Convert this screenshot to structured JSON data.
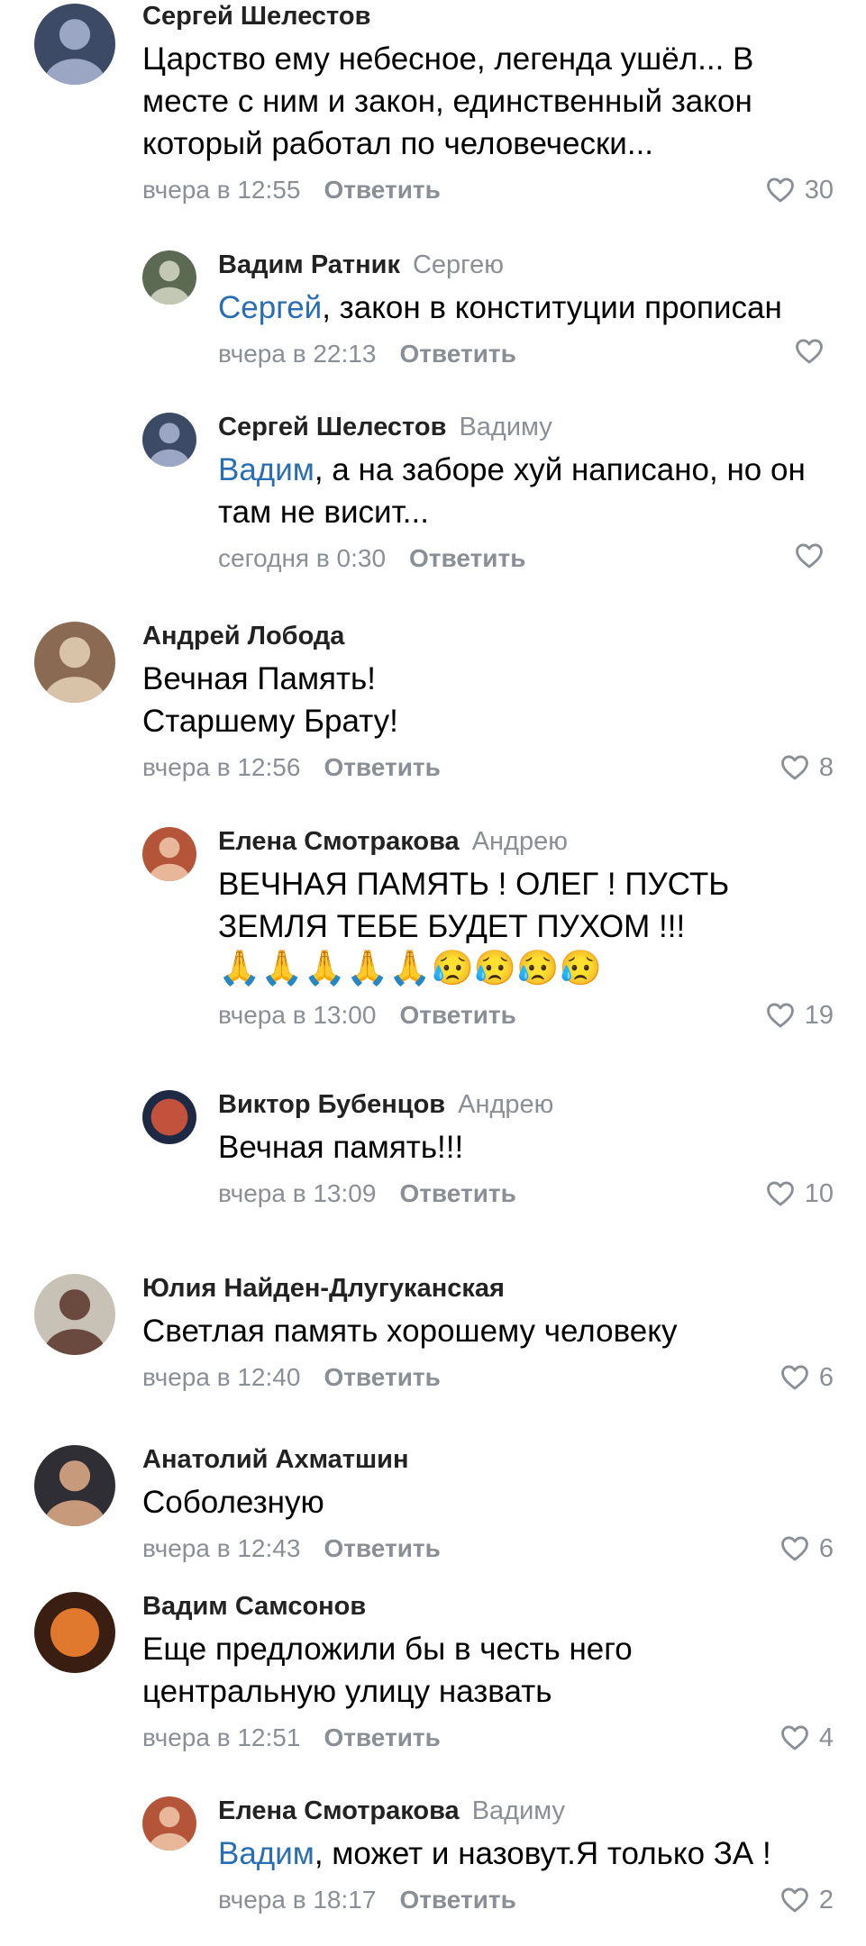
{
  "reply_label": "Ответить",
  "comments": [
    {
      "id": "c1",
      "level": 0,
      "author": "Сергей Шелестов",
      "text": "Царство ему небесное, легенда ушёл... В месте с ним и закон, единственный закон который работал по человечески...",
      "time": "вчера в 12:55",
      "likes": "30",
      "avatar": {
        "bg": "#3c4a66",
        "fg": "#9aa6c4"
      }
    },
    {
      "id": "c2",
      "level": 1,
      "author": "Вадим Ратник",
      "addressee": "Сергею",
      "mention": "Сергей",
      "text": ", закон в конституции прописан",
      "time": "вчера в 22:13",
      "likes": "",
      "avatar": {
        "bg": "#5c6a54",
        "fg": "#c2c8b3"
      }
    },
    {
      "id": "c3",
      "level": 1,
      "author": "Сергей Шелестов",
      "addressee": "Вадиму",
      "mention": "Вадим",
      "text": ", а на заборе хуй написано, но он там не висит...",
      "time": "сегодня в 0:30",
      "likes": "",
      "avatar": {
        "bg": "#3c4a66",
        "fg": "#9aa6c4"
      }
    },
    {
      "id": "c4",
      "level": 0,
      "author": "Андрей Лобода",
      "lines": [
        "Вечная Память!",
        "Старшему Брату!"
      ],
      "time": "вчера в 12:56",
      "likes": "8",
      "avatar": {
        "bg": "#8a6a52",
        "fg": "#d8c2a8"
      }
    },
    {
      "id": "c5",
      "level": 1,
      "author": "Елена Смотракова",
      "addressee": "Андрею",
      "text": "ВЕЧНАЯ ПАМЯТЬ !  ОЛЕГ ! ПУСТЬ ЗЕМЛЯ ТЕБЕ БУДЕТ ПУХОМ !!!",
      "emoji_text": "🙏🙏🙏🙏🙏😥😥😥😥",
      "time": "вчера в 13:00",
      "likes": "19",
      "avatar": {
        "bg": "#b4553a",
        "fg": "#e8b79a"
      }
    },
    {
      "id": "c6",
      "level": 1,
      "author": "Виктор Бубенцов",
      "addressee": "Андрею",
      "text": "Вечная память!!!",
      "time": "вчера в 13:09",
      "likes": "10",
      "avatar": {
        "bg": "#1e2a44",
        "fg": "#c2523c"
      }
    },
    {
      "id": "c7",
      "level": 0,
      "author": "Юлия Найден-Длугуканская",
      "text": "Светлая память хорошему человеку",
      "time": "вчера в 12:40",
      "likes": "6",
      "avatar": {
        "bg": "#c8c2b6",
        "fg": "#6a4a3e"
      }
    },
    {
      "id": "c8",
      "level": 0,
      "author": "Анатолий Ахматшин",
      "text": "Соболезную",
      "time": "вчера в 12:43",
      "likes": "6",
      "avatar": {
        "bg": "#2e2e34",
        "fg": "#c89a7c"
      }
    },
    {
      "id": "c9",
      "level": 0,
      "author": "Вадим Самсонов",
      "text": "Еще предложили бы в честь него центральную улицу назвать",
      "time": "вчера в 12:51",
      "likes": "4",
      "avatar": {
        "bg": "#3a1e12",
        "fg": "#e0782e"
      }
    },
    {
      "id": "c10",
      "level": 1,
      "author": "Елена Смотракова",
      "addressee": "Вадиму",
      "mention": "Вадим",
      "text": ", может и назовут.Я только ЗА !",
      "time": "вчера в 18:17",
      "likes": "2",
      "avatar": {
        "bg": "#b4553a",
        "fg": "#e8b79a"
      }
    }
  ]
}
